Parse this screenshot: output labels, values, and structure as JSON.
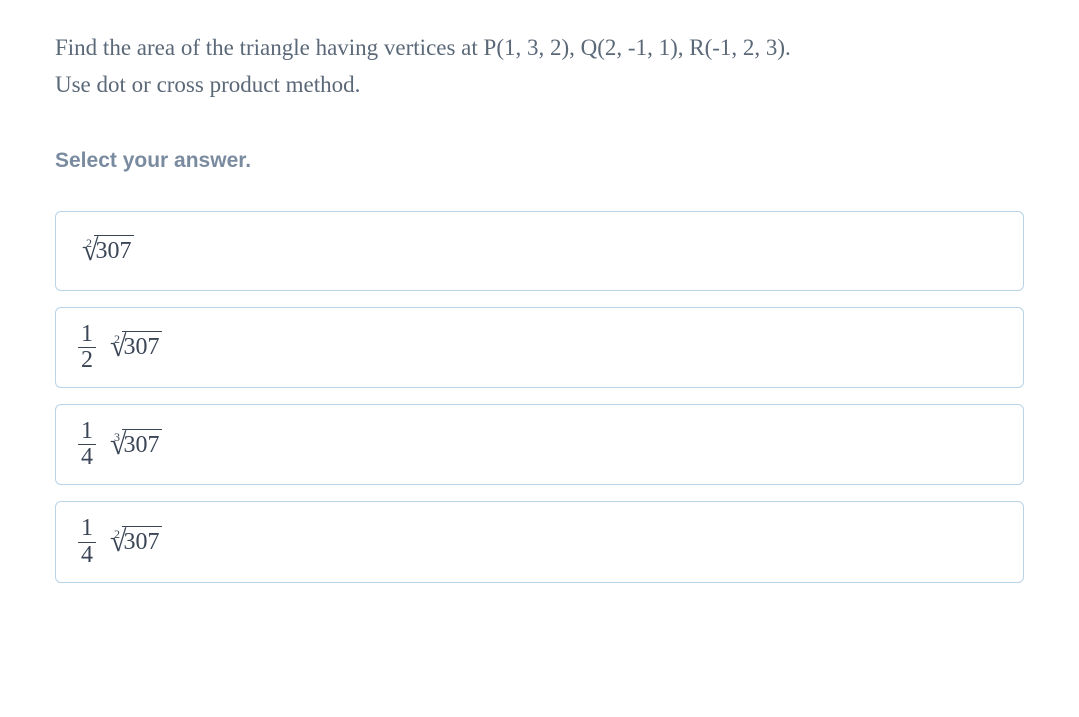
{
  "question": {
    "text_line1": "Find the area of the triangle having vertices at P(1, 3, 2), Q(2, -1, 1), R(-1, 2, 3).",
    "text_line2": "Use dot or cross product method."
  },
  "instruction": "Select your answer.",
  "options": [
    {
      "fraction": null,
      "root_index": "2",
      "radicand": "307"
    },
    {
      "fraction": {
        "num": "1",
        "den": "2"
      },
      "root_index": "2",
      "radicand": "307"
    },
    {
      "fraction": {
        "num": "1",
        "den": "4"
      },
      "root_index": "3",
      "radicand": "307"
    },
    {
      "fraction": {
        "num": "1",
        "den": "4"
      },
      "root_index": "2",
      "radicand": "307"
    }
  ]
}
